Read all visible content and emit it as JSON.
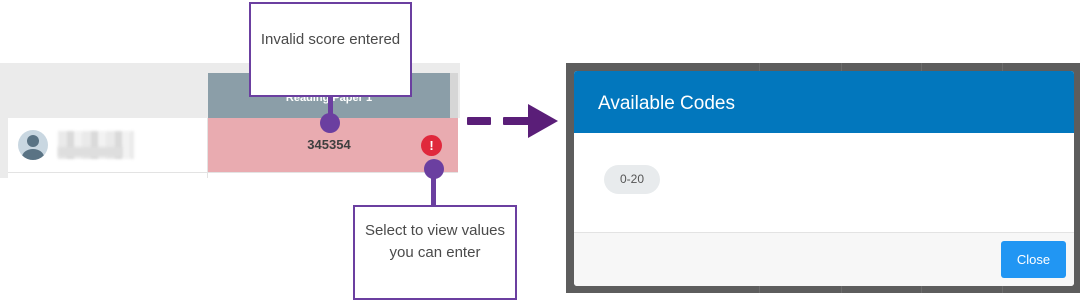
{
  "grid": {
    "column_header": "Reading Paper 1",
    "score_value": "345354",
    "error_icon": "!"
  },
  "callouts": {
    "invalid_score": "Invalid score entered",
    "select_to_view": "Select to view values you can enter"
  },
  "modal": {
    "title": "Available Codes",
    "codes": [
      "0-20"
    ],
    "close_label": "Close"
  },
  "colors": {
    "accent_purple": "#6b3fa0",
    "modal_header": "#0277bd",
    "close_button": "#2196f3",
    "invalid_cell": "#e9abb0",
    "error_red": "#e0283c"
  },
  "icons": {
    "avatar": "user-avatar-icon",
    "error": "exclamation-circle-icon",
    "arrow": "dashed-arrow-right-icon"
  }
}
